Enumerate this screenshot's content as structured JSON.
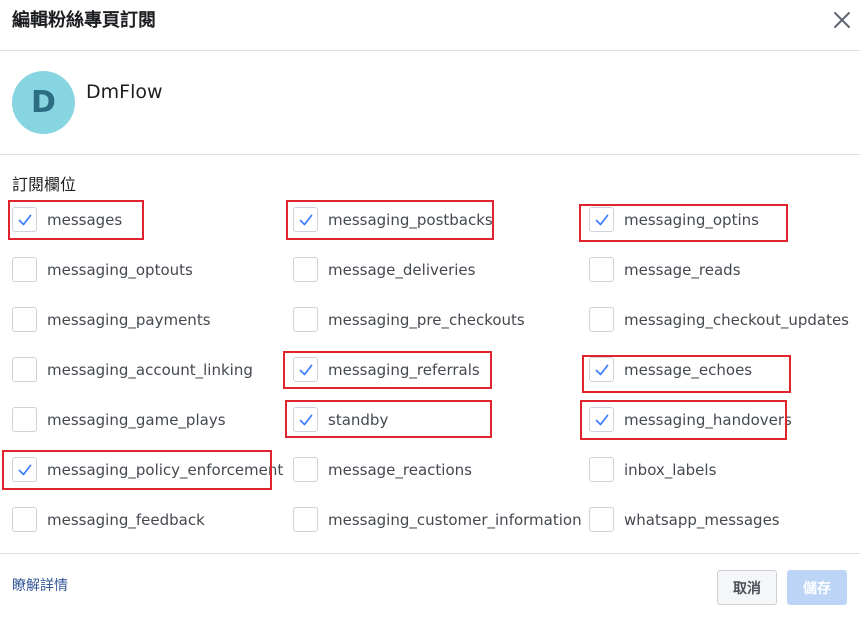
{
  "dialog": {
    "title": "編輯粉絲專頁訂閱",
    "close_icon": "close-icon"
  },
  "page": {
    "avatar_letter": "D",
    "avatar_color": "#88d5e2",
    "name": "DmFlow"
  },
  "section_label": "訂閱欄位",
  "fields": [
    {
      "label": "messages",
      "checked": true,
      "highlighted": true
    },
    {
      "label": "messaging_postbacks",
      "checked": true,
      "highlighted": true
    },
    {
      "label": "messaging_optins",
      "checked": true,
      "highlighted": true
    },
    {
      "label": "messaging_optouts",
      "checked": false,
      "highlighted": false
    },
    {
      "label": "message_deliveries",
      "checked": false,
      "highlighted": false
    },
    {
      "label": "message_reads",
      "checked": false,
      "highlighted": false
    },
    {
      "label": "messaging_payments",
      "checked": false,
      "highlighted": false
    },
    {
      "label": "messaging_pre_checkouts",
      "checked": false,
      "highlighted": false
    },
    {
      "label": "messaging_checkout_updates",
      "checked": false,
      "highlighted": false
    },
    {
      "label": "messaging_account_linking",
      "checked": false,
      "highlighted": false
    },
    {
      "label": "messaging_referrals",
      "checked": true,
      "highlighted": true
    },
    {
      "label": "message_echoes",
      "checked": true,
      "highlighted": true
    },
    {
      "label": "messaging_game_plays",
      "checked": false,
      "highlighted": false
    },
    {
      "label": "standby",
      "checked": true,
      "highlighted": true
    },
    {
      "label": "messaging_handovers",
      "checked": true,
      "highlighted": true
    },
    {
      "label": "messaging_policy_enforcement",
      "checked": true,
      "highlighted": true
    },
    {
      "label": "message_reactions",
      "checked": false,
      "highlighted": false
    },
    {
      "label": "inbox_labels",
      "checked": false,
      "highlighted": false
    },
    {
      "label": "messaging_feedback",
      "checked": false,
      "highlighted": false
    },
    {
      "label": "messaging_customer_information",
      "checked": false,
      "highlighted": false
    },
    {
      "label": "whatsapp_messages",
      "checked": false,
      "highlighted": false
    }
  ],
  "footer": {
    "learn_more": "瞭解詳情",
    "cancel_label": "取消",
    "save_label": "儲存"
  },
  "colors": {
    "check": "#4080ff",
    "highlight_border": "#e0242e",
    "link": "#365899",
    "save_disabled": "#bcd4f6"
  }
}
